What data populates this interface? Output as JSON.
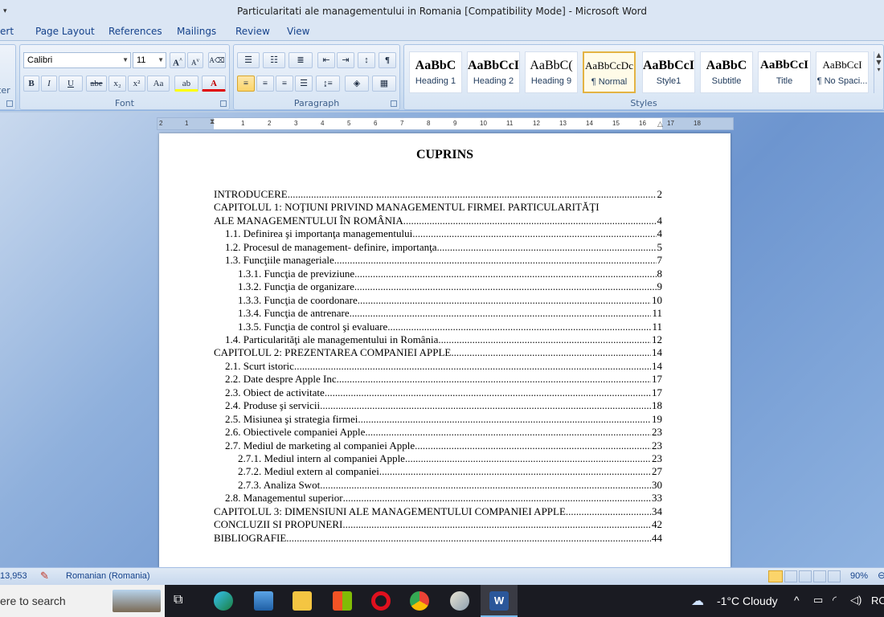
{
  "window": {
    "title": "Particularitati ale managementului in Romania [Compatibility Mode] - Microsoft Word"
  },
  "tabs": [
    "ert",
    "Page Layout",
    "References",
    "Mailings",
    "Review",
    "View"
  ],
  "ribbon": {
    "clipboard_fragment": "ter",
    "font": {
      "label": "Font",
      "name": "Calibri",
      "size": "11",
      "grow": "A",
      "shrink": "A",
      "bold": "B",
      "italic": "I",
      "underline": "U",
      "strike": "abe",
      "subscript": "x₂",
      "superscript": "x²",
      "change_case": "Aa",
      "highlight": "ab",
      "font_color": "A"
    },
    "paragraph": {
      "label": "Paragraph",
      "pilcrow": "¶"
    },
    "styles": {
      "label": "Styles",
      "items": [
        {
          "sample": "AaBbC",
          "name": "Heading 1",
          "active": false
        },
        {
          "sample": "AaBbCcI",
          "name": "Heading 2",
          "active": false
        },
        {
          "sample": "AaBbC(",
          "name": "Heading 9",
          "active": false
        },
        {
          "sample": "AaBbCcDc",
          "name": "¶ Normal",
          "active": true
        },
        {
          "sample": "AaBbCcI",
          "name": "Style1",
          "active": false
        },
        {
          "sample": "AaBbC",
          "name": "Subtitle",
          "active": false
        },
        {
          "sample": "AaBbCcI",
          "name": "Title",
          "active": false
        },
        {
          "sample": "AaBbCcI",
          "name": "¶ No Spaci...",
          "active": false
        }
      ]
    }
  },
  "ruler": {
    "ticks": [
      "2",
      "1",
      "1",
      "2",
      "3",
      "4",
      "5",
      "6",
      "7",
      "8",
      "9",
      "10",
      "11",
      "12",
      "13",
      "14",
      "15",
      "16",
      "17",
      "18"
    ]
  },
  "document": {
    "title": "CUPRINS",
    "toc": [
      {
        "label": "INTRODUCERE",
        "page": "2",
        "level": 0
      },
      {
        "label": "CAPITOLUL 1: NOŢIUNI PRIVIND MANAGEMENTUL FIRMEI. PARTICULARITĂŢI",
        "page": "",
        "level": 0
      },
      {
        "label": "ALE MANAGEMENTULUI ÎN ROMÂNIA",
        "page": "4",
        "level": 0
      },
      {
        "label": "1.1. Definirea şi importanţa managementului",
        "page": "4",
        "level": 1
      },
      {
        "label": "1.2. Procesul de management- definire, importanţa",
        "page": "5",
        "level": 1
      },
      {
        "label": "1.3. Funcţiile manageriale",
        "page": "7",
        "level": 1
      },
      {
        "label": "1.3.1. Funcţia de previziune",
        "page": "8",
        "level": 2
      },
      {
        "label": "1.3.2. Funcţia de organizare",
        "page": "9",
        "level": 2
      },
      {
        "label": "1.3.3. Funcţia de coordonare",
        "page": "10",
        "level": 2
      },
      {
        "label": "1.3.4.  Funcţia de antrenare",
        "page": "11",
        "level": 2
      },
      {
        "label": "1.3.5. Funcţia de control şi evaluare",
        "page": "11",
        "level": 2
      },
      {
        "label": "1.4. Particularităţi ale managementului in România",
        "page": "12",
        "level": 1
      },
      {
        "label": "CAPITOLUL 2: PREZENTAREA COMPANIEI APPLE",
        "page": "14",
        "level": 0
      },
      {
        "label": "2.1. Scurt istoric",
        "page": "14",
        "level": 1
      },
      {
        "label": "2.2. Date despre Apple Inc.",
        "page": "17",
        "level": 1
      },
      {
        "label": "2.3. Obiect de activitate",
        "page": "17",
        "level": 1
      },
      {
        "label": "2.4. Produse şi servicii",
        "page": "18",
        "level": 1
      },
      {
        "label": "2.5. Misiunea şi strategia firmei",
        "page": "19",
        "level": 1
      },
      {
        "label": "2.6. Obiectivele companiei Apple",
        "page": "23",
        "level": 1
      },
      {
        "label": "2.7. Mediul de marketing al companiei Apple",
        "page": "23",
        "level": 1
      },
      {
        "label": "2.7.1. Mediul intern al companiei Apple",
        "page": "23",
        "level": 2
      },
      {
        "label": "2.7.2. Mediul extern al companiei",
        "page": "27",
        "level": 2
      },
      {
        "label": "2.7.3. Analiza Swot",
        "page": "30",
        "level": 2
      },
      {
        "label": "2.8. Managementul superior",
        "page": "33",
        "level": 1
      },
      {
        "label": "CAPITOLUL 3: DIMENSIUNI ALE MANAGEMENTULUI COMPANIEI APPLE",
        "page": "34",
        "level": 0
      },
      {
        "label": "CONCLUZII SI PROPUNERI",
        "page": "42",
        "level": 0
      },
      {
        "label": "BIBLIOGRAFIE",
        "page": "44",
        "level": 0
      }
    ]
  },
  "statusbar": {
    "word_count": "13,953",
    "language": "Romanian (Romania)",
    "zoom": "90%"
  },
  "taskbar": {
    "search_placeholder": "ere to search",
    "weather": "-1°C  Cloudy",
    "locale": "RO"
  },
  "colors": {
    "accent": "#2b579a",
    "page": "#ffffff",
    "workspace": "#7b9fd4"
  }
}
